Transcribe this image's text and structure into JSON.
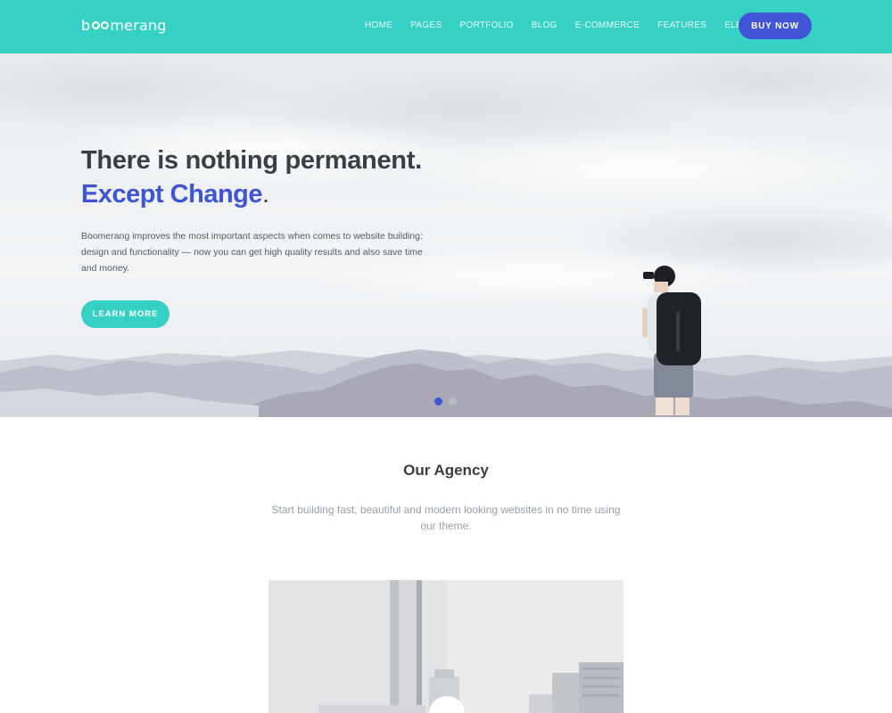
{
  "brand": {
    "logo_prefix": "b",
    "logo_suffix": "merang",
    "accent": "#36d1c4",
    "primary": "#3f55d6"
  },
  "nav": {
    "items": [
      "HOME",
      "PAGES",
      "PORTFOLIO",
      "BLOG",
      "E-COMMERCE",
      "FEATURES",
      "ELEMENTS"
    ],
    "cta_label": "BUY NOW"
  },
  "hero": {
    "title": "There is nothing permanent.",
    "subtitle": "Except Change",
    "subtitle_punct": ".",
    "description": "Boomerang improves the most important aspects when comes to website building: design and functionality — now you can get high quality results and also save time and money.",
    "button_label": "LEARN MORE",
    "slides_total": 2,
    "slide_active": 1
  },
  "agency": {
    "title": "Our Agency",
    "description": "Start building fast, beautiful and modern looking websites in no time using our theme."
  }
}
